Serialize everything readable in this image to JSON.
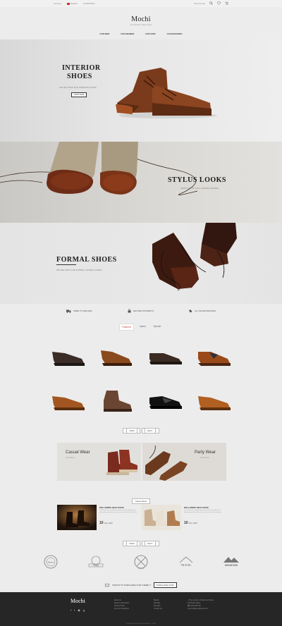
{
  "topbar": {
    "account": "Account",
    "language": "English",
    "phone": "1234567890",
    "account_right": "My Account"
  },
  "brand": {
    "logo": "Mochi",
    "tagline": "The Premium Shoes Store"
  },
  "nav": {
    "items": [
      "FOR MEN",
      "FOR WOMEN",
      "FOR KIDS",
      "ACCESSORIES"
    ]
  },
  "banners": [
    {
      "title_line1": "INTERIOR",
      "title_line2": "SHOES",
      "subtitle": "ONLINE SHOP FOR INTERIOR SHOES",
      "button": "SHOP NOW"
    },
    {
      "title": "STYLUS LOOKS",
      "subtitle": "SHOP FOR STYLUS LOOKING SHAPES"
    },
    {
      "title": "FORMAL SHOES",
      "subtitle": "ONLINE SHOP FOR FORMAL LOOKING SHOES"
    }
  ],
  "features": [
    "FREE TO DELIVER",
    "SECURE PAYMENTS",
    "ALL SHOES BRANDS"
  ],
  "tabs": [
    "Featured",
    "Latest",
    "Special"
  ],
  "pager": {
    "prev": "PREV",
    "next": "NEXT"
  },
  "promos": [
    {
      "title": "Casual Wear",
      "subtitle": "2b Products"
    },
    {
      "title": "Party Wear",
      "subtitle": "2b Products"
    }
  ],
  "latest_news": {
    "title": "Latest News"
  },
  "blogs": [
    {
      "title": "DOLLAPEPE HELP GOOD",
      "text": "Lorem ipsum is simply dummy text of the printing and typesetting industry lorem ipsum has been the industry",
      "day": "10",
      "month": "JAN, 2018"
    },
    {
      "title": "DOLLAPEPE HELP GOOD",
      "text": "Lorem ipsum is simply dummy text of the printing and typesetting industry lorem ipsum has been the industry",
      "day": "10",
      "month": "JAN, 2018"
    }
  ],
  "brands": [
    "Brand",
    "Vintage",
    "Brand",
    "TRAVEL",
    "MOUNTAIN"
  ],
  "newsletter": {
    "text": "WANTS TO PURCHASE OUR THEME ?",
    "button": "PURCHASE NOW"
  },
  "footer": {
    "logo": "Mochi",
    "col1": [
      "About Us",
      "Delivery Information",
      "Privacy Policy",
      "Terms & Conditions"
    ],
    "col2": [
      "Brands",
      "Specials",
      "Site Map",
      "Contact Us"
    ],
    "col3": [
      "The Lorenzo, 43 Seymour Street,",
      "Southwest Street",
      "(123) 456-789",
      "demo@yourdomain.com"
    ],
    "copyright": "Powered by OpenCart Demo Store © 2018"
  },
  "colors": {
    "accent": "#c44444",
    "footer_bg": "#262626",
    "page_bg": "#ececec"
  }
}
